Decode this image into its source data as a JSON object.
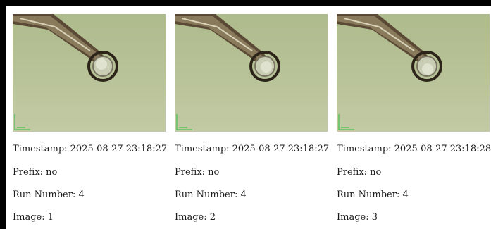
{
  "cards": [
    {
      "image_icon": "microscope-crystal-loop-image",
      "timestamp": "Timestamp: 2025-08-27 23:18:27",
      "prefix": "Prefix: no",
      "run_number": "Run Number: 4",
      "image": "Image: 1"
    },
    {
      "image_icon": "microscope-crystal-loop-image",
      "timestamp": "Timestamp: 2025-08-27 23:18:27",
      "prefix": "Prefix: no",
      "run_number": "Run Number: 4",
      "image": "Image: 2"
    },
    {
      "image_icon": "microscope-crystal-loop-image",
      "timestamp": "Timestamp: 2025-08-27 23:18:28",
      "prefix": "Prefix: no",
      "run_number": "Run Number: 4",
      "image": "Image: 3"
    }
  ],
  "colors": {
    "background_bar": "#000000",
    "image_background": "#b9c39a",
    "loop_stem": "#3b2f22",
    "scale_bar": "#2fbf3f",
    "text": "#1a1a1a"
  }
}
